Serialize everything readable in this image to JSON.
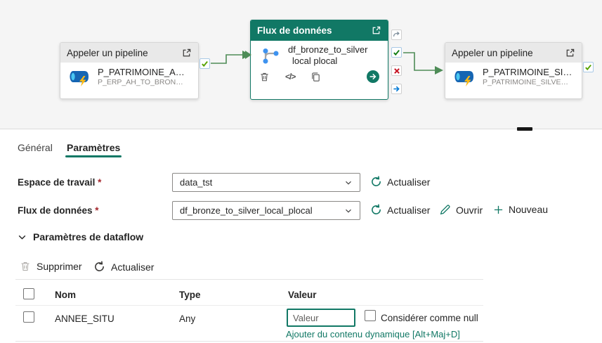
{
  "canvas": {
    "node1": {
      "type_label": "Appeler un pipeline",
      "name": "P_PATRIMOINE_A…",
      "subtitle": "P_ERP_AH_TO_BRON…"
    },
    "node2": {
      "type_label": "Flux de données",
      "name_line1": "df_bronze_to_silver",
      "name_line2": "local plocal",
      "code_glyph": "</>"
    },
    "node3": {
      "type_label": "Appeler un pipeline",
      "name": "P_PATRIMOINE_SI…",
      "subtitle": "P_PATRIMOINE_SILVE…"
    }
  },
  "panel": {
    "tab_general": "Général",
    "tab_parameters": "Paramètres",
    "workspace": {
      "label": "Espace de travail",
      "required": "*",
      "value": "data_tst",
      "refresh_label": "Actualiser"
    },
    "dataflow": {
      "label": "Flux de données",
      "required": "*",
      "value": "df_bronze_to_silver_local_plocal",
      "refresh_label": "Actualiser",
      "open_label": "Ouvrir",
      "new_label": "Nouveau"
    },
    "section_title": "Paramètres de dataflow",
    "toolbar": {
      "delete_label": "Supprimer",
      "refresh_label": "Actualiser"
    },
    "table": {
      "header_name": "Nom",
      "header_type": "Type",
      "header_value": "Valeur",
      "row": {
        "name": "ANNEE_SITU",
        "type": "Any",
        "value_placeholder": "Valeur",
        "null_label": "Considérer comme null"
      },
      "dynamic_link": "Ajouter du contenu dynamique [Alt+Maj+D]"
    }
  },
  "colors": {
    "accent_teal": "#117865",
    "connector_line_green": "#4e8c57",
    "success_check_green": "#57a300",
    "status_success_green": "#107c10",
    "status_error_red": "#c50f1f",
    "status_info_blue": "#0078d4"
  }
}
